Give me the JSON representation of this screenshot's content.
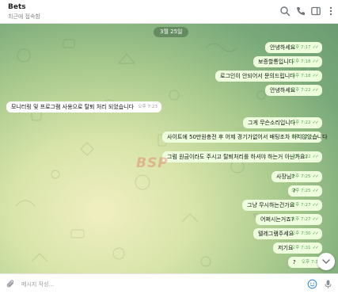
{
  "header": {
    "title": "Bets",
    "subtitle": "최근에 접속함"
  },
  "icons": [
    "search-icon",
    "phone-icon",
    "sidebar-icon",
    "more-icon",
    "chevron-down-icon",
    "paperclip-icon",
    "emoji-icon",
    "microphone-icon"
  ],
  "chat": {
    "date_chip": "3월 25일",
    "watermark": "BSP",
    "messages": [
      {
        "dir": "out",
        "text": "안녕하세요",
        "time": "오후 7:17"
      },
      {
        "dir": "out",
        "text": "보증할통입니다",
        "time": "오후 7:18"
      },
      {
        "dir": "out",
        "text": "로그인이 안되어서 문의드립니다",
        "time": "오후 7:18"
      },
      {
        "dir": "out",
        "text": "안녕하세요",
        "time": "오후 7:22"
      },
      {
        "dir": "in",
        "text": "모니터링 및 프로그램 사용으로 탈퇴 처리 되었습니다",
        "time": "오후 7:23"
      },
      {
        "dir": "out",
        "text": "그게 무슨소리입니다",
        "time": "오후 7:22"
      },
      {
        "dir": "out",
        "text": "사이트에 50만원충전 후 어제 경기가없어서 배팅조차 하지않았습니다",
        "time": "오후 7:22"
      },
      {
        "dir": "out",
        "text": "그럼 원금이라도 주시고 탈퇴처리를 하셔야 하는거 아닌가요?",
        "time": "오후 7:22"
      },
      {
        "dir": "out",
        "text": "사장님?",
        "time": "오후 7:25"
      },
      {
        "dir": "out",
        "text": "?",
        "time": "오후 7:25"
      },
      {
        "dir": "out",
        "text": "그냥 무시하는건가요",
        "time": "오후 7:27"
      },
      {
        "dir": "out",
        "text": "어쩌시는거죠?",
        "time": "오후 7:27"
      },
      {
        "dir": "out",
        "text": "텔레그램주세요",
        "time": "오후 7:30"
      },
      {
        "dir": "out",
        "text": "저기요",
        "time": "오후 7:31"
      },
      {
        "dir": "out",
        "text": "?",
        "time": "오후 7:3"
      }
    ]
  },
  "composer": {
    "placeholder": "메시지 작성..."
  },
  "colors": {
    "outgoing_bubble": "#eeffde",
    "incoming_bubble": "#ffffff",
    "check_green": "#5ea75b"
  }
}
